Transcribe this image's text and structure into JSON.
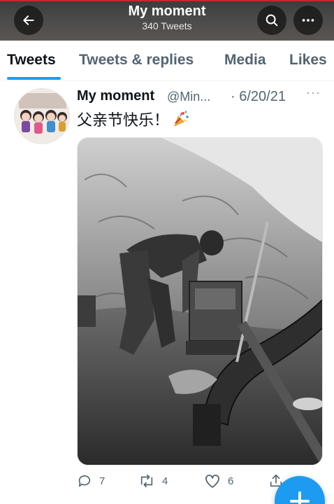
{
  "header": {
    "title": "My moment",
    "subtitle": "340 Tweets",
    "back_icon": "arrow-left-icon",
    "search_icon": "search-icon",
    "more_icon": "more-horizontal-icon"
  },
  "tabs": [
    {
      "label": "Tweets",
      "active": true
    },
    {
      "label": "Tweets & replies",
      "active": false
    },
    {
      "label": "Media",
      "active": false
    },
    {
      "label": "Likes",
      "active": false
    }
  ],
  "tweet": {
    "name": "My moment",
    "handle": "@Min...",
    "date": "· 6/20/21",
    "more": "···",
    "text": "父亲节快乐！",
    "emoji_icon": "party-popper-icon",
    "actions": {
      "replies": "7",
      "retweets": "4",
      "likes": "6"
    }
  },
  "colors": {
    "accent": "#1d9bf0",
    "text_primary": "#0f1419",
    "text_secondary": "#536471"
  }
}
